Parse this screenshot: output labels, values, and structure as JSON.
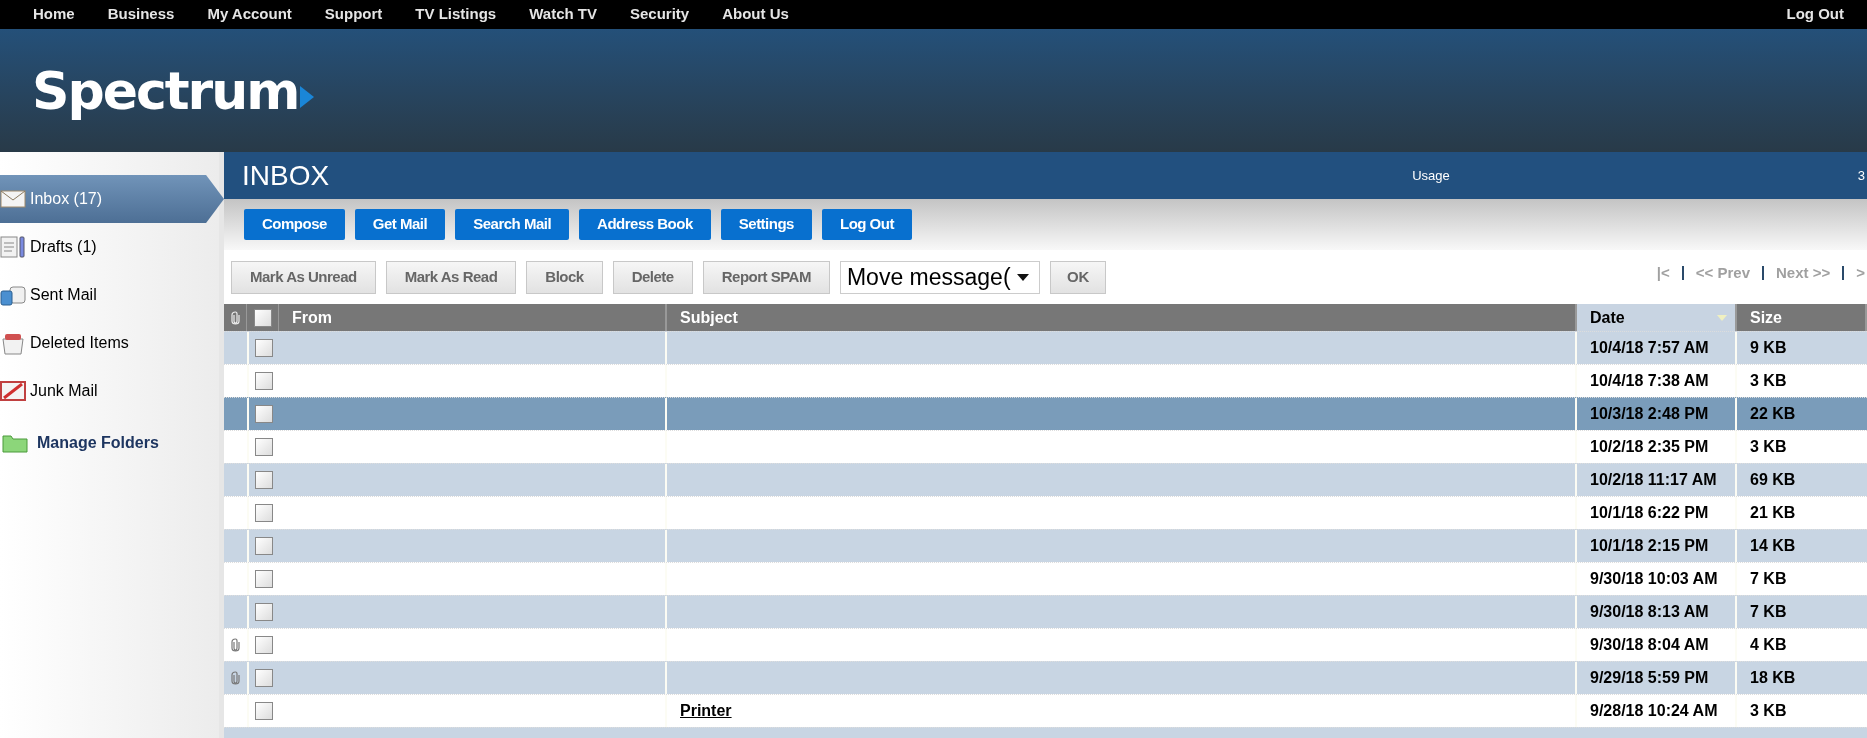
{
  "top_nav": {
    "links": [
      "Home",
      "Business",
      "My Account",
      "Support",
      "TV Listings",
      "Watch TV",
      "Security",
      "About Us"
    ],
    "logout": "Log Out"
  },
  "logo": "Spectrum",
  "sidebar": {
    "items": [
      {
        "kind": "inbox",
        "label": "Inbox (17)",
        "selected": true
      },
      {
        "kind": "drafts",
        "label": "Drafts (1)",
        "selected": false
      },
      {
        "kind": "sent",
        "label": "Sent Mail",
        "selected": false
      },
      {
        "kind": "deleted",
        "label": "Deleted Items",
        "selected": false
      },
      {
        "kind": "junk",
        "label": "Junk Mail",
        "selected": false
      }
    ],
    "manage": "Manage Folders"
  },
  "title_bar": {
    "title": "INBOX",
    "usage": "Usage",
    "column_3": "3"
  },
  "main_buttons": [
    "Compose",
    "Get Mail",
    "Search Mail",
    "Address Book",
    "Settings",
    "Log Out"
  ],
  "action_buttons": [
    "Mark As Unread",
    "Mark As Read",
    "Block",
    "Delete",
    "Report SPAM"
  ],
  "move_select": "Move message(",
  "ok_button": "OK",
  "pagination": [
    "|<",
    "<< Prev",
    "Next >>",
    ">"
  ],
  "table": {
    "header_checked": false,
    "columns": [
      {
        "label": "From",
        "sorted": false
      },
      {
        "label": "Subject",
        "sorted": false
      },
      {
        "label": "Date",
        "sorted": true
      },
      {
        "label": "Size",
        "sorted": false
      }
    ],
    "rows": [
      {
        "attachment": false,
        "checked": false,
        "selected": false,
        "date": "10/4/18 7:57 AM",
        "size": "9 KB"
      },
      {
        "attachment": false,
        "checked": false,
        "selected": false,
        "date": "10/4/18 7:38 AM",
        "size": "3 KB"
      },
      {
        "attachment": false,
        "checked": false,
        "selected": true,
        "date": "10/3/18 2:48 PM",
        "size": "22 KB"
      },
      {
        "attachment": false,
        "checked": false,
        "selected": false,
        "date": "10/2/18 2:35 PM",
        "size": "3 KB"
      },
      {
        "attachment": false,
        "checked": false,
        "selected": false,
        "date": "10/2/18 11:17 AM",
        "size": "69 KB"
      },
      {
        "attachment": false,
        "checked": false,
        "selected": false,
        "date": "10/1/18 6:22 PM",
        "size": "21 KB"
      },
      {
        "attachment": false,
        "checked": false,
        "selected": false,
        "date": "10/1/18 2:15 PM",
        "size": "14 KB"
      },
      {
        "attachment": false,
        "checked": false,
        "selected": false,
        "date": "9/30/18 10:03 AM",
        "size": "7 KB"
      },
      {
        "attachment": false,
        "checked": false,
        "selected": false,
        "date": "9/30/18 8:13 AM",
        "size": "7 KB"
      },
      {
        "attachment": true,
        "checked": false,
        "selected": false,
        "date": "9/30/18 8:04 AM",
        "size": "4 KB"
      },
      {
        "attachment": true,
        "checked": false,
        "selected": false,
        "date": "9/29/18 5:59 PM",
        "size": "18 KB"
      },
      {
        "attachment": false,
        "checked": false,
        "selected": false,
        "subject": "Printer",
        "date": "9/28/18 10:24 AM",
        "size": "3 KB"
      }
    ]
  }
}
